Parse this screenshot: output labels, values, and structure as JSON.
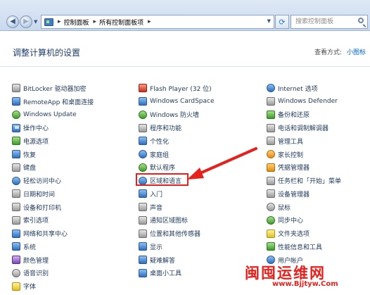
{
  "address_bar": {
    "breadcrumbs": [
      "控制面板",
      "所有控制面板项"
    ],
    "search_placeholder": "搜索控制面板"
  },
  "header": {
    "title": "调整计算机的设置",
    "view_by_label": "查看方式:",
    "view_mode": "小图标"
  },
  "items": {
    "column1": [
      {
        "label": "BitLocker 驱动器加密",
        "icon": "bitlocker-icon"
      },
      {
        "label": "RemoteApp 和桌面连接",
        "icon": "remoteapp-icon"
      },
      {
        "label": "Windows Update",
        "icon": "windows-update-icon"
      },
      {
        "label": "操作中心",
        "icon": "action-center-flag-icon"
      },
      {
        "label": "电源选项",
        "icon": "power-options-icon"
      },
      {
        "label": "恢复",
        "icon": "recovery-icon"
      },
      {
        "label": "键盘",
        "icon": "keyboard-icon"
      },
      {
        "label": "轻松访问中心",
        "icon": "ease-of-access-icon"
      },
      {
        "label": "日期和时间",
        "icon": "date-time-icon"
      },
      {
        "label": "设备和打印机",
        "icon": "devices-printers-icon"
      },
      {
        "label": "索引选项",
        "icon": "indexing-icon"
      },
      {
        "label": "网络和共享中心",
        "icon": "network-sharing-icon"
      },
      {
        "label": "系统",
        "icon": "system-icon"
      },
      {
        "label": "颜色管理",
        "icon": "color-management-icon"
      },
      {
        "label": "语音识别",
        "icon": "speech-recognition-icon"
      },
      {
        "label": "字体",
        "icon": "fonts-icon"
      }
    ],
    "column2": [
      {
        "label": "Flash Player (32 位)",
        "icon": "flash-player-icon"
      },
      {
        "label": "Windows CardSpace",
        "icon": "cardspace-icon"
      },
      {
        "label": "Windows 防火墙",
        "icon": "firewall-icon"
      },
      {
        "label": "程序和功能",
        "icon": "programs-features-icon"
      },
      {
        "label": "个性化",
        "icon": "personalization-icon"
      },
      {
        "label": "家庭组",
        "icon": "homegroup-icon"
      },
      {
        "label": "默认程序",
        "icon": "default-programs-icon"
      },
      {
        "label": "区域和语言",
        "icon": "region-language-icon"
      },
      {
        "label": "入门",
        "icon": "getting-started-icon"
      },
      {
        "label": "声音",
        "icon": "sound-icon"
      },
      {
        "label": "通知区域图标",
        "icon": "notification-icons-icon"
      },
      {
        "label": "位置和其他传感器",
        "icon": "location-sensors-icon"
      },
      {
        "label": "显示",
        "icon": "display-icon"
      },
      {
        "label": "疑难解答",
        "icon": "troubleshooting-icon"
      },
      {
        "label": "桌面小工具",
        "icon": "desktop-gadgets-icon"
      }
    ],
    "column3": [
      {
        "label": "Internet 选项",
        "icon": "internet-options-icon"
      },
      {
        "label": "Windows Defender",
        "icon": "windows-defender-icon"
      },
      {
        "label": "备份和还原",
        "icon": "backup-restore-icon"
      },
      {
        "label": "电话和调制解调器",
        "icon": "phone-modem-icon"
      },
      {
        "label": "管理工具",
        "icon": "admin-tools-icon"
      },
      {
        "label": "家长控制",
        "icon": "parental-controls-icon"
      },
      {
        "label": "凭据管理器",
        "icon": "credential-manager-icon"
      },
      {
        "label": "任务栏和「开始」菜单",
        "icon": "taskbar-start-icon"
      },
      {
        "label": "设备管理器",
        "icon": "device-manager-icon"
      },
      {
        "label": "鼠标",
        "icon": "mouse-icon"
      },
      {
        "label": "同步中心",
        "icon": "sync-center-icon"
      },
      {
        "label": "文件夹选项",
        "icon": "folder-options-icon"
      },
      {
        "label": "性能信息和工具",
        "icon": "performance-icon"
      },
      {
        "label": "用户帐户",
        "icon": "user-accounts-icon"
      }
    ]
  },
  "watermark": {
    "logo_text": "闽囤运维网",
    "url": "www.Bjjtyw.Com"
  },
  "colors": {
    "annotation_red": "#e8201c",
    "link_blue": "#0066cc"
  }
}
